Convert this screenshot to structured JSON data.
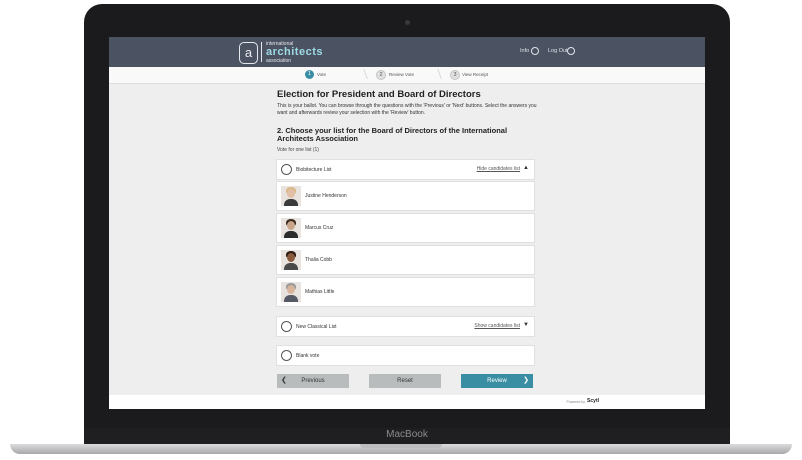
{
  "device": {
    "label": "MacBook"
  },
  "header": {
    "logo_letter": "a",
    "logo_top": "international",
    "logo_main": "architects",
    "logo_bottom": "association",
    "info_label": "Info",
    "logout_label": "Log Out"
  },
  "steps": [
    {
      "num": "1",
      "label": "Vote"
    },
    {
      "num": "2",
      "label": "Review Vote"
    },
    {
      "num": "3",
      "label": "View Receipt"
    }
  ],
  "page": {
    "title": "Election for President and Board of Directors",
    "intro": "This is your ballot. You can browse through the questions with the 'Previous' or 'Next' buttons. Select the answers you want and afterwards review your selection with the 'Review' button.",
    "question": "2. Choose your list for the Board of Directors of the International Architects Association",
    "hint": "Vote for one list (1)"
  },
  "lists": [
    {
      "name": "Biobitecture List",
      "toggle": "Hide candidates list"
    },
    {
      "name": "New Classical List",
      "toggle": "Show candidates list"
    },
    {
      "name": "Blank vote"
    }
  ],
  "candidates": [
    {
      "name": "Justine Henderson"
    },
    {
      "name": "Marcus Cruz"
    },
    {
      "name": "Thalia Cobb"
    },
    {
      "name": "Mathias Little"
    }
  ],
  "buttons": {
    "previous": "Previous",
    "reset": "Reset",
    "review": "Review"
  },
  "footer": {
    "powered": "Powered by",
    "brand": "Scytl"
  },
  "colors": {
    "accent": "#3a8ea3",
    "header": "#4b5262"
  }
}
